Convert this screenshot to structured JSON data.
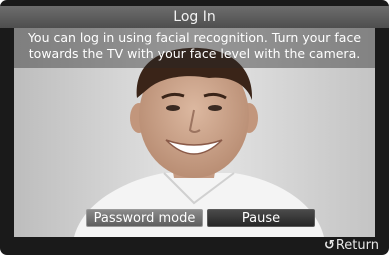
{
  "dialog": {
    "title": "Log In",
    "instruction_line1": "You can log in using facial recognition. Turn your face",
    "instruction_line2": "towards the TV with your face level with the camera."
  },
  "buttons": {
    "password_mode": "Password mode",
    "pause": "Pause"
  },
  "footer": {
    "return_icon": "↺",
    "return_label": "Return"
  },
  "colors": {
    "frame": "#1a1a1a",
    "title_bar": "#5e5e5e",
    "button_selected": "#6e6e6e",
    "button_default": "#303030"
  },
  "icons": [
    "return-icon"
  ]
}
